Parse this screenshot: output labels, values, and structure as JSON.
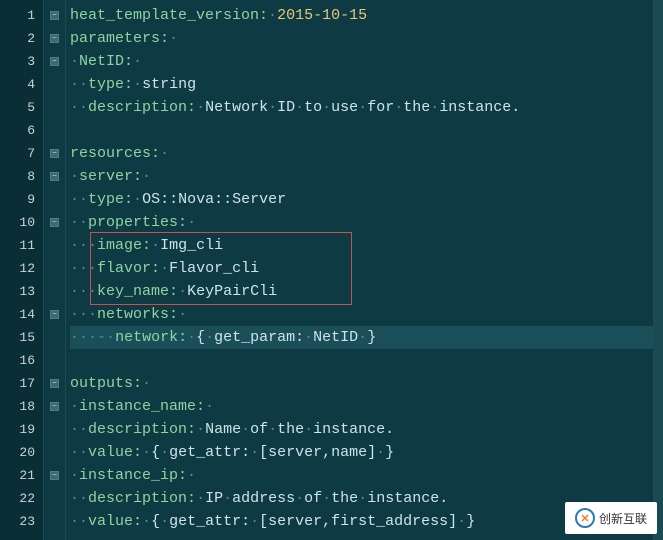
{
  "gutter": {
    "line_numbers": [
      "1",
      "2",
      "3",
      "4",
      "5",
      "6",
      "7",
      "8",
      "9",
      "10",
      "11",
      "12",
      "13",
      "14",
      "15",
      "16",
      "17",
      "18",
      "19",
      "20",
      "21",
      "22",
      "23"
    ],
    "fold_markers": {
      "1": "-",
      "2": "-",
      "3": "-",
      "7": "-",
      "8": "-",
      "10": "-",
      "14": "-",
      "17": "-",
      "18": "-",
      "21": "-"
    }
  },
  "code": {
    "lines": [
      {
        "key": "heat_template_version:",
        "value": "2015-10-15",
        "indent": 0,
        "value_class": "yellow"
      },
      {
        "key": "parameters:",
        "value": "",
        "indent": 0
      },
      {
        "key": "NetID:",
        "value": "",
        "indent": 1
      },
      {
        "key": "type:",
        "value": "string",
        "indent": 2
      },
      {
        "key": "description:",
        "value": "Network·ID·to·use·for·the·instance.",
        "indent": 2
      },
      {
        "key": "",
        "value": "",
        "indent": 0
      },
      {
        "key": "resources:",
        "value": "",
        "indent": 0
      },
      {
        "key": "server:",
        "value": "",
        "indent": 1
      },
      {
        "key": "type:",
        "value": "OS::Nova::Server",
        "indent": 2
      },
      {
        "key": "properties:",
        "value": "",
        "indent": 2
      },
      {
        "key": "image:",
        "value": "Img_cli",
        "indent": 3
      },
      {
        "key": "flavor:",
        "value": "Flavor_cli",
        "indent": 3
      },
      {
        "key": "key_name:",
        "value": "KeyPairCli",
        "indent": 3
      },
      {
        "key": "networks:",
        "value": "",
        "indent": 3
      },
      {
        "key": "network:",
        "value": "{·get_param:·NetID·}",
        "indent": 3,
        "dash": true
      },
      {
        "key": "",
        "value": "",
        "indent": 0
      },
      {
        "key": "outputs:",
        "value": "",
        "indent": 0
      },
      {
        "key": "instance_name:",
        "value": "",
        "indent": 1
      },
      {
        "key": "description:",
        "value": "Name·of·the·instance.",
        "indent": 2
      },
      {
        "key": "value:",
        "value": "{·get_attr:·[server,name]·}",
        "indent": 2
      },
      {
        "key": "instance_ip:",
        "value": "",
        "indent": 1
      },
      {
        "key": "description:",
        "value": "IP·address·of·the·instance.",
        "indent": 2
      },
      {
        "key": "value:",
        "value": "{·get_attr:·[server,first_address]·}",
        "indent": 2
      }
    ]
  },
  "highlight": {
    "top_line": 11,
    "bottom_line": 13
  },
  "current_line": 15,
  "watermark": {
    "text": "创新互联"
  }
}
